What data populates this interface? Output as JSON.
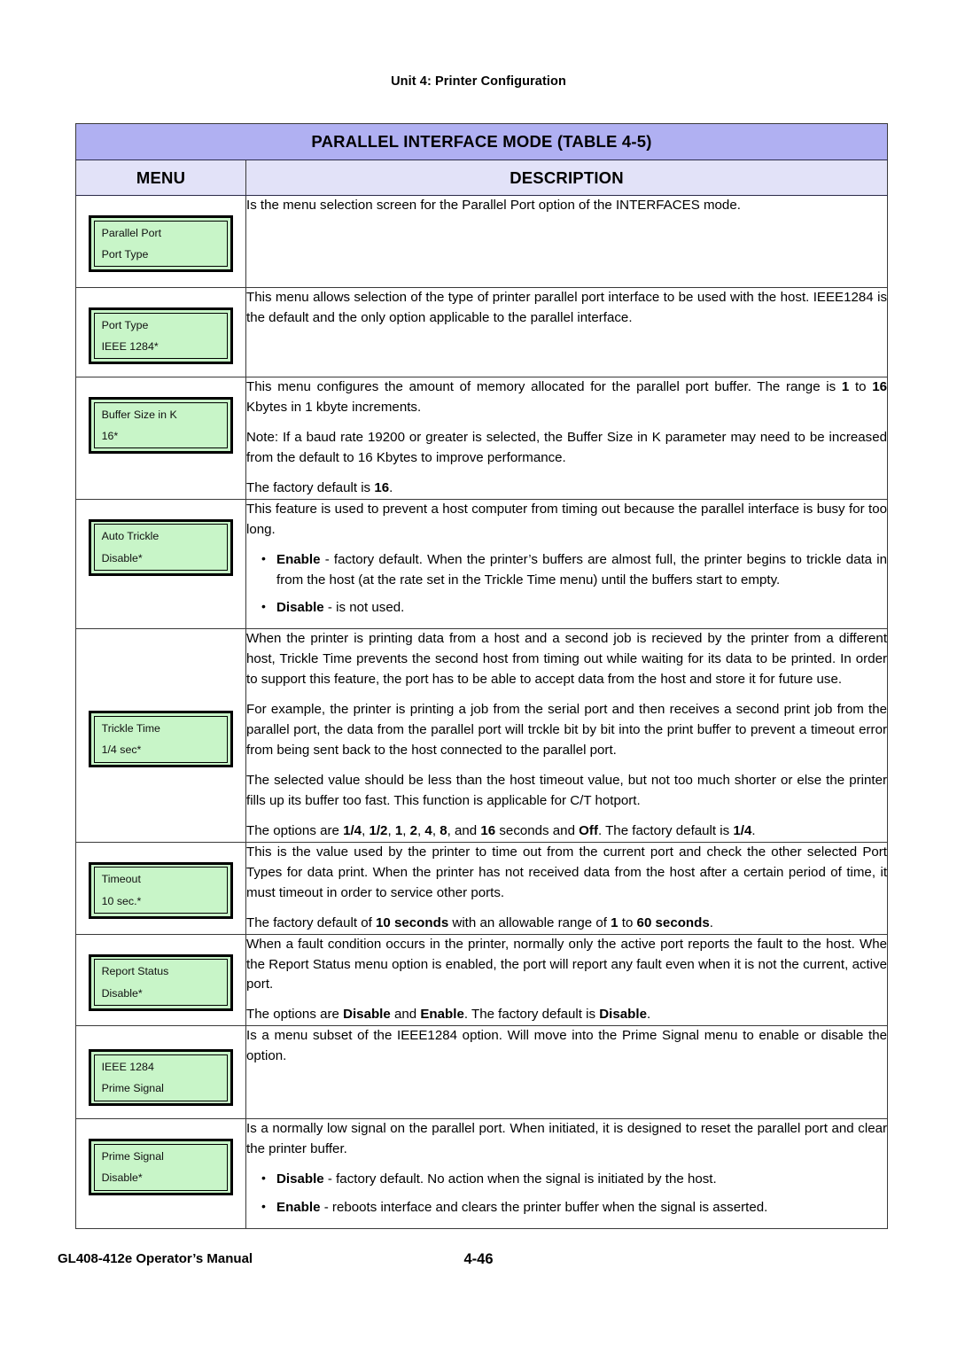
{
  "page": {
    "running_head": "Unit 4:  Printer Configuration",
    "footer_left": "GL408-412e Operator’s Manual",
    "footer_page": "4-46"
  },
  "colors": {
    "title_bg": "#b0b0f2",
    "header_bg": "#e2e2f8",
    "lcd_fill": "#c8f5c8",
    "border": "#000000"
  },
  "table": {
    "title": "PARALLEL INTERFACE MODE (TABLE 4-5)",
    "columns": {
      "menu": "MENU",
      "description": "DESCRIPTION"
    },
    "rows": [
      {
        "menu": {
          "line1": "Parallel Port",
          "line2": "Port Type"
        },
        "description": {
          "p1": "Is the menu selection screen for the Parallel Port option of the INTERFACES mode."
        }
      },
      {
        "menu": {
          "line1": "Port Type",
          "line2": "IEEE 1284*"
        },
        "description": {
          "p1": "This menu allows selection of the type of printer parallel port interface to be used with the host. IEEE1284 is the default and the only option applicable to the parallel interface."
        }
      },
      {
        "menu": {
          "line1": "Buffer Size in K",
          "line2": "16*"
        },
        "description": {
          "p1_a": "This menu configures the amount of memory allocated for the parallel port buffer. The range is ",
          "p1_b": "1",
          "p1_c": " to ",
          "p1_d": "16",
          "p1_e": " Kbytes in 1 kbyte increments.",
          "p2": "Note: If a baud rate 19200 or greater is selected, the Buffer Size in K parameter may need to be increased from the default to 16 Kbytes to improve performance.",
          "p3_a": "The factory default is ",
          "p3_b": "16",
          "p3_c": "."
        }
      },
      {
        "menu": {
          "line1": "Auto Trickle",
          "line2": "Disable*"
        },
        "description": {
          "p1": "This feature is used to prevent a host computer from timing out because the parallel interface is busy for too long.",
          "b1_label": "Enable",
          "b1_text": " - factory default. When the printer’s buffers are almost full, the printer begins to trickle data in from the host (at the rate set in the Trickle Time menu) until the buffers start to empty.",
          "b2_label": "Disable",
          "b2_text": " - is not used."
        }
      },
      {
        "menu": {
          "line1": "Trickle Time",
          "line2": "1/4 sec*"
        },
        "description": {
          "p1": "When the printer is printing data from a host and a second job is recieved by the printer from a different host, Trickle Time prevents the second host from timing out while waiting for its data to be printed. In order to support this feature, the port has to be able to accept data from the host and store it for future use.",
          "p2": "For example, the printer is printing a job from the serial port and then receives a second print job from the parallel port, the data from the parallel port will trckle bit by bit into the print buffer to prevent a timeout error from being sent back to the host connected to the parallel port.",
          "p3": "The selected value should be less than the host timeout value, but not too much shorter or else the printer fills up its buffer too fast. This function is applicable for C/T hotport.",
          "p4_a": "The options are ",
          "p4_b": "1/4",
          "p4_c": ", ",
          "p4_d": "1/2",
          "p4_e": ", ",
          "p4_f": "1",
          "p4_g": ", ",
          "p4_h": "2",
          "p4_i": ", ",
          "p4_j": "4",
          "p4_k": ", ",
          "p4_l": "8",
          "p4_m": ", and ",
          "p4_n": "16",
          "p4_o": " seconds and ",
          "p4_p": "Off",
          "p4_q": ". The factory default is ",
          "p4_r": "1/4",
          "p4_s": "."
        }
      },
      {
        "menu": {
          "line1": "Timeout",
          "line2": "10 sec.*"
        },
        "description": {
          "p1": "This is the value used by the printer to time out from the current port and check the other selected Port Types for data print. When the printer has not received data from the host after a certain period of time, it must timeout in order to service other ports.",
          "p2_a": "The factory default of ",
          "p2_b": "10 seconds",
          "p2_c": " with an allowable range of ",
          "p2_d": "1",
          "p2_e": " to ",
          "p2_f": "60 seconds",
          "p2_g": "."
        }
      },
      {
        "menu": {
          "line1": "Report Status",
          "line2": "Disable*"
        },
        "description": {
          "p1": "When a fault condition occurs in the printer, normally only the active port reports the fault to the host. Whe the Report Status menu option is enabled, the port will report any fault even when it is not the current, active port.",
          "p2_a": "The options are ",
          "p2_b": "Disable",
          "p2_c": " and ",
          "p2_d": "Enable",
          "p2_e": ". The factory default is ",
          "p2_f": "Disable",
          "p2_g": "."
        }
      },
      {
        "menu": {
          "line1": "IEEE 1284",
          "line2": "Prime Signal"
        },
        "description": {
          "p1": "Is a menu subset of the IEEE1284 option. Will move into the Prime Signal menu to enable or disable the option."
        }
      },
      {
        "menu": {
          "line1": "Prime Signal",
          "line2": "Disable*"
        },
        "description": {
          "p1": "Is a normally low signal on the parallel port. When initiated, it is designed to reset the parallel port and clear the printer buffer.",
          "b1_label": "Disable",
          "b1_text": " - factory default. No action when the signal is initiated by the host.",
          "b2_label": "Enable",
          "b2_text": " - reboots interface and clears the printer buffer when the signal is asserted."
        }
      }
    ]
  }
}
